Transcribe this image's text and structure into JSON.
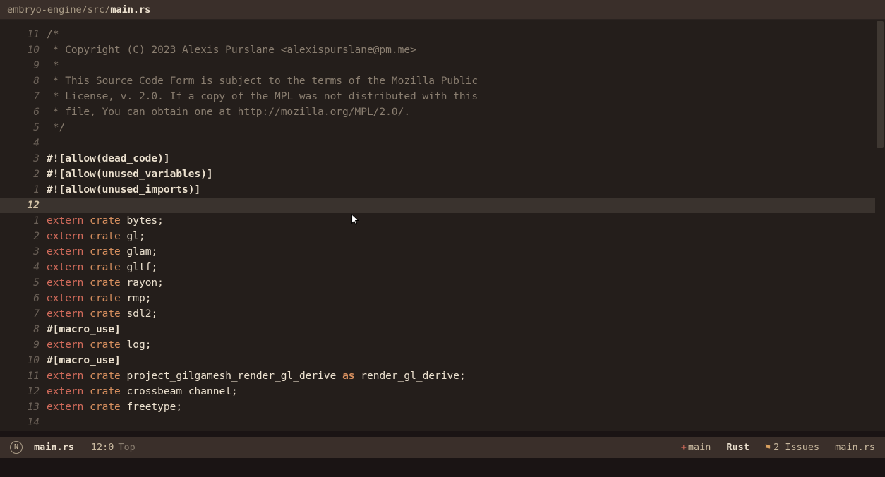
{
  "breadcrumb": {
    "path": "embryo-engine/src/",
    "file": "main.rs"
  },
  "cursor_line_abs": 12,
  "lines": [
    {
      "num": "11",
      "tokens": [
        {
          "t": "/*",
          "c": "comment"
        }
      ]
    },
    {
      "num": "10",
      "tokens": [
        {
          "t": " * Copyright (C) 2023 Alexis Purslane <alexispurslane@pm.me>",
          "c": "comment"
        }
      ]
    },
    {
      "num": "9",
      "tokens": [
        {
          "t": " *",
          "c": "comment"
        }
      ]
    },
    {
      "num": "8",
      "tokens": [
        {
          "t": " * This Source Code Form is subject to the terms of the Mozilla Public",
          "c": "comment"
        }
      ]
    },
    {
      "num": "7",
      "tokens": [
        {
          "t": " * License, v. 2.0. If a copy of the MPL was not distributed with this",
          "c": "comment"
        }
      ]
    },
    {
      "num": "6",
      "tokens": [
        {
          "t": " * file, You can obtain one at http://mozilla.org/MPL/2.0/.",
          "c": "comment"
        }
      ]
    },
    {
      "num": "5",
      "tokens": [
        {
          "t": " */",
          "c": "comment"
        }
      ]
    },
    {
      "num": "4",
      "tokens": []
    },
    {
      "num": "3",
      "tokens": [
        {
          "t": "#![allow(dead_code)]",
          "c": "attr"
        }
      ]
    },
    {
      "num": "2",
      "tokens": [
        {
          "t": "#![allow(unused_variables)]",
          "c": "attr"
        }
      ]
    },
    {
      "num": "1",
      "tokens": [
        {
          "t": "#![allow(unused_imports)]",
          "c": "attr"
        }
      ]
    },
    {
      "num": "12",
      "current": true,
      "tokens": []
    },
    {
      "num": "1",
      "tokens": [
        {
          "t": "extern",
          "c": "kw"
        },
        {
          "t": " ",
          "c": "p"
        },
        {
          "t": "crate",
          "c": "kw2"
        },
        {
          "t": " ",
          "c": "p"
        },
        {
          "t": "bytes",
          "c": "ident"
        },
        {
          "t": ";",
          "c": "p"
        }
      ]
    },
    {
      "num": "2",
      "tokens": [
        {
          "t": "extern",
          "c": "kw"
        },
        {
          "t": " ",
          "c": "p"
        },
        {
          "t": "crate",
          "c": "kw2"
        },
        {
          "t": " ",
          "c": "p"
        },
        {
          "t": "gl",
          "c": "ident"
        },
        {
          "t": ";",
          "c": "p"
        }
      ]
    },
    {
      "num": "3",
      "tokens": [
        {
          "t": "extern",
          "c": "kw"
        },
        {
          "t": " ",
          "c": "p"
        },
        {
          "t": "crate",
          "c": "kw2"
        },
        {
          "t": " ",
          "c": "p"
        },
        {
          "t": "glam",
          "c": "ident"
        },
        {
          "t": ";",
          "c": "p"
        }
      ]
    },
    {
      "num": "4",
      "tokens": [
        {
          "t": "extern",
          "c": "kw"
        },
        {
          "t": " ",
          "c": "p"
        },
        {
          "t": "crate",
          "c": "kw2"
        },
        {
          "t": " ",
          "c": "p"
        },
        {
          "t": "gltf",
          "c": "ident"
        },
        {
          "t": ";",
          "c": "p"
        }
      ]
    },
    {
      "num": "5",
      "tokens": [
        {
          "t": "extern",
          "c": "kw"
        },
        {
          "t": " ",
          "c": "p"
        },
        {
          "t": "crate",
          "c": "kw2"
        },
        {
          "t": " ",
          "c": "p"
        },
        {
          "t": "rayon",
          "c": "ident"
        },
        {
          "t": ";",
          "c": "p"
        }
      ]
    },
    {
      "num": "6",
      "tokens": [
        {
          "t": "extern",
          "c": "kw"
        },
        {
          "t": " ",
          "c": "p"
        },
        {
          "t": "crate",
          "c": "kw2"
        },
        {
          "t": " ",
          "c": "p"
        },
        {
          "t": "rmp",
          "c": "ident"
        },
        {
          "t": ";",
          "c": "p"
        }
      ]
    },
    {
      "num": "7",
      "tokens": [
        {
          "t": "extern",
          "c": "kw"
        },
        {
          "t": " ",
          "c": "p"
        },
        {
          "t": "crate",
          "c": "kw2"
        },
        {
          "t": " ",
          "c": "p"
        },
        {
          "t": "sdl2",
          "c": "ident"
        },
        {
          "t": ";",
          "c": "p"
        }
      ]
    },
    {
      "num": "8",
      "tokens": [
        {
          "t": "#[macro_use]",
          "c": "attr"
        }
      ]
    },
    {
      "num": "9",
      "tokens": [
        {
          "t": "extern",
          "c": "kw"
        },
        {
          "t": " ",
          "c": "p"
        },
        {
          "t": "crate",
          "c": "kw2"
        },
        {
          "t": " ",
          "c": "p"
        },
        {
          "t": "log",
          "c": "ident"
        },
        {
          "t": ";",
          "c": "p"
        }
      ]
    },
    {
      "num": "10",
      "tokens": [
        {
          "t": "#[macro_use]",
          "c": "attr"
        }
      ]
    },
    {
      "num": "11",
      "tokens": [
        {
          "t": "extern",
          "c": "kw"
        },
        {
          "t": " ",
          "c": "p"
        },
        {
          "t": "crate",
          "c": "kw2"
        },
        {
          "t": " ",
          "c": "p"
        },
        {
          "t": "project_gilgamesh_render_gl_derive",
          "c": "ident"
        },
        {
          "t": " ",
          "c": "p"
        },
        {
          "t": "as",
          "c": "as"
        },
        {
          "t": " ",
          "c": "p"
        },
        {
          "t": "render_gl_derive",
          "c": "ident"
        },
        {
          "t": ";",
          "c": "p"
        }
      ]
    },
    {
      "num": "12",
      "tokens": [
        {
          "t": "extern",
          "c": "kw"
        },
        {
          "t": " ",
          "c": "p"
        },
        {
          "t": "crate",
          "c": "kw2"
        },
        {
          "t": " ",
          "c": "p"
        },
        {
          "t": "crossbeam_channel",
          "c": "ident"
        },
        {
          "t": ";",
          "c": "p"
        }
      ]
    },
    {
      "num": "13",
      "tokens": [
        {
          "t": "extern",
          "c": "kw"
        },
        {
          "t": " ",
          "c": "p"
        },
        {
          "t": "crate",
          "c": "kw2"
        },
        {
          "t": " ",
          "c": "p"
        },
        {
          "t": "freetype",
          "c": "ident"
        },
        {
          "t": ";",
          "c": "p"
        }
      ]
    },
    {
      "num": "14",
      "tokens": []
    }
  ],
  "statusbar": {
    "mode_letter": "N",
    "filename": "main.rs",
    "position": "12:0",
    "scroll": "Top",
    "branch_prefix": "+",
    "branch": "main",
    "language": "Rust",
    "flag_icon": "⚑",
    "issues": "2 Issues",
    "right_file": "main.rs"
  }
}
